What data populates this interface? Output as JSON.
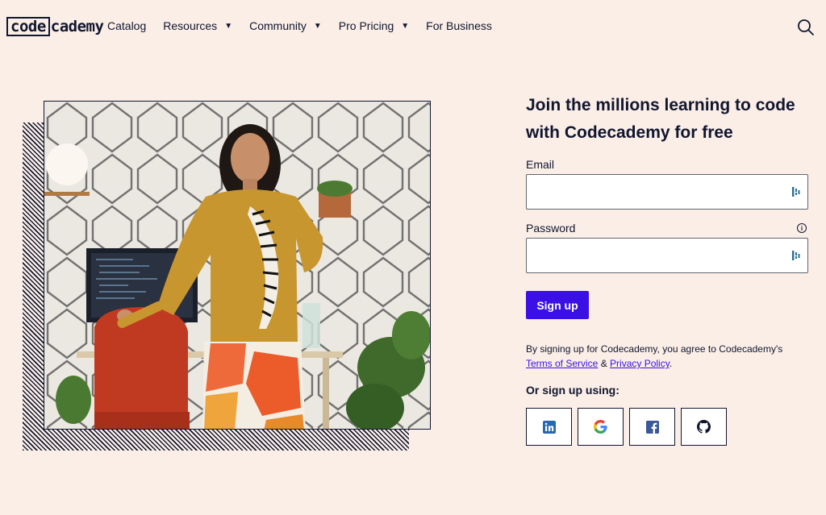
{
  "nav": {
    "logo_box": "code",
    "logo_rest": "cademy",
    "items": [
      {
        "label": "Catalog",
        "has_caret": false
      },
      {
        "label": "Resources",
        "has_caret": true
      },
      {
        "label": "Community",
        "has_caret": true
      },
      {
        "label": "Pro Pricing",
        "has_caret": true
      },
      {
        "label": "For Business",
        "has_caret": false
      }
    ],
    "caret": "▼",
    "search_icon": "search-icon"
  },
  "hero": {
    "image": "photo-woman-yellow-sweater"
  },
  "form": {
    "headline_line1": "Join the millions learning to code",
    "headline_line2": "with Codecademy for free",
    "email_label": "Email",
    "email_value": "",
    "password_label": "Password",
    "password_value": "",
    "info_glyph": "i",
    "signup_label": "Sign up",
    "terms_prefix": "By signing up for Codecademy, you agree to Codecademy's",
    "terms_link": "Terms of Service",
    "terms_amp": " & ",
    "privacy_link": "Privacy Policy",
    "terms_suffix": ".",
    "or_label": "Or sign up using:",
    "social": [
      "linkedin-icon",
      "google-icon",
      "facebook-icon",
      "github-icon"
    ]
  },
  "colors": {
    "background": "#fbeee6",
    "navy": "#10162f",
    "accent": "#3a10e5",
    "sweater": "#c8962e"
  }
}
